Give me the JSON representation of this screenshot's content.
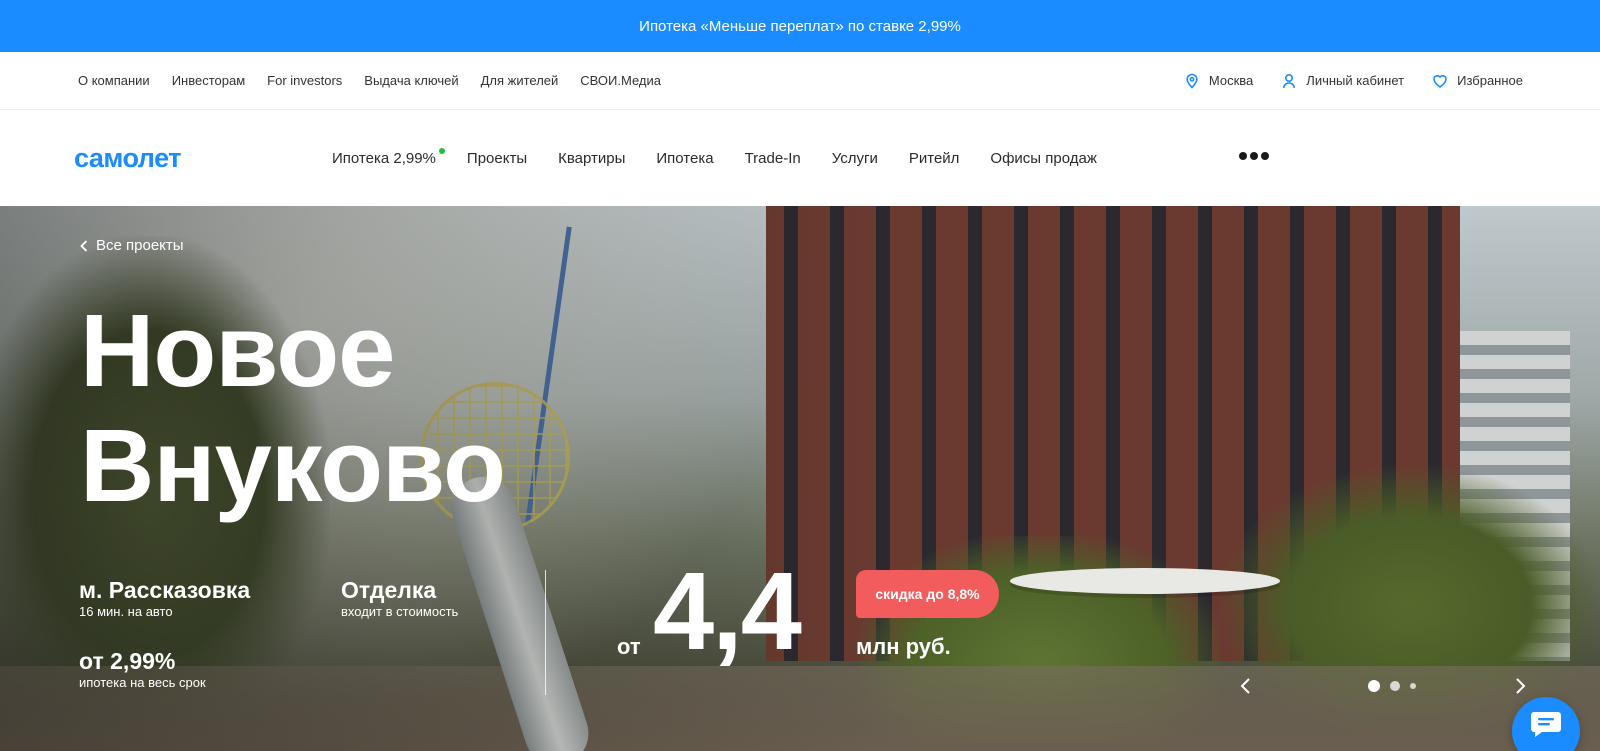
{
  "promo": {
    "text": "Ипотека «Меньше переплат» по ставке 2,99%"
  },
  "util_nav": {
    "items": [
      "О компании",
      "Инвесторам",
      "For investors",
      "Выдача ключей",
      "Для жителей",
      "СВОИ.Медиа"
    ],
    "city": "Москва",
    "account": "Личный кабинет",
    "favorites": "Избранное"
  },
  "main_nav": {
    "logo": "самолет",
    "items": [
      "Ипотека 2,99%",
      "Проекты",
      "Квартиры",
      "Ипотека",
      "Trade-In",
      "Услуги",
      "Ритейл",
      "Офисы продаж"
    ],
    "accent_dot_color": "#1bbf3a"
  },
  "hero": {
    "back_link": "Все проекты",
    "title_line1": "Новое",
    "title_line2": "Внуково",
    "facts": {
      "metro": "м. Рассказовка",
      "metro_sub": "16 мин. на авто",
      "finish": "Отделка",
      "finish_sub": "входит в стоимость",
      "rate": "от 2,99%",
      "rate_sub": "ипотека на весь срок"
    },
    "price_from": "от",
    "price_value": "4,4",
    "price_unit": "млн руб.",
    "discount": "скидка до 8,8%"
  },
  "slider": {
    "active_index": 0,
    "slide_count": 3
  },
  "colors": {
    "brand": "#1a8cff",
    "discount": "#f35c5c"
  },
  "icons": [
    "location-pin-icon",
    "user-icon",
    "heart-icon",
    "chevron-left-icon",
    "chevron-right-icon",
    "chat-icon",
    "more-dots-icon"
  ]
}
